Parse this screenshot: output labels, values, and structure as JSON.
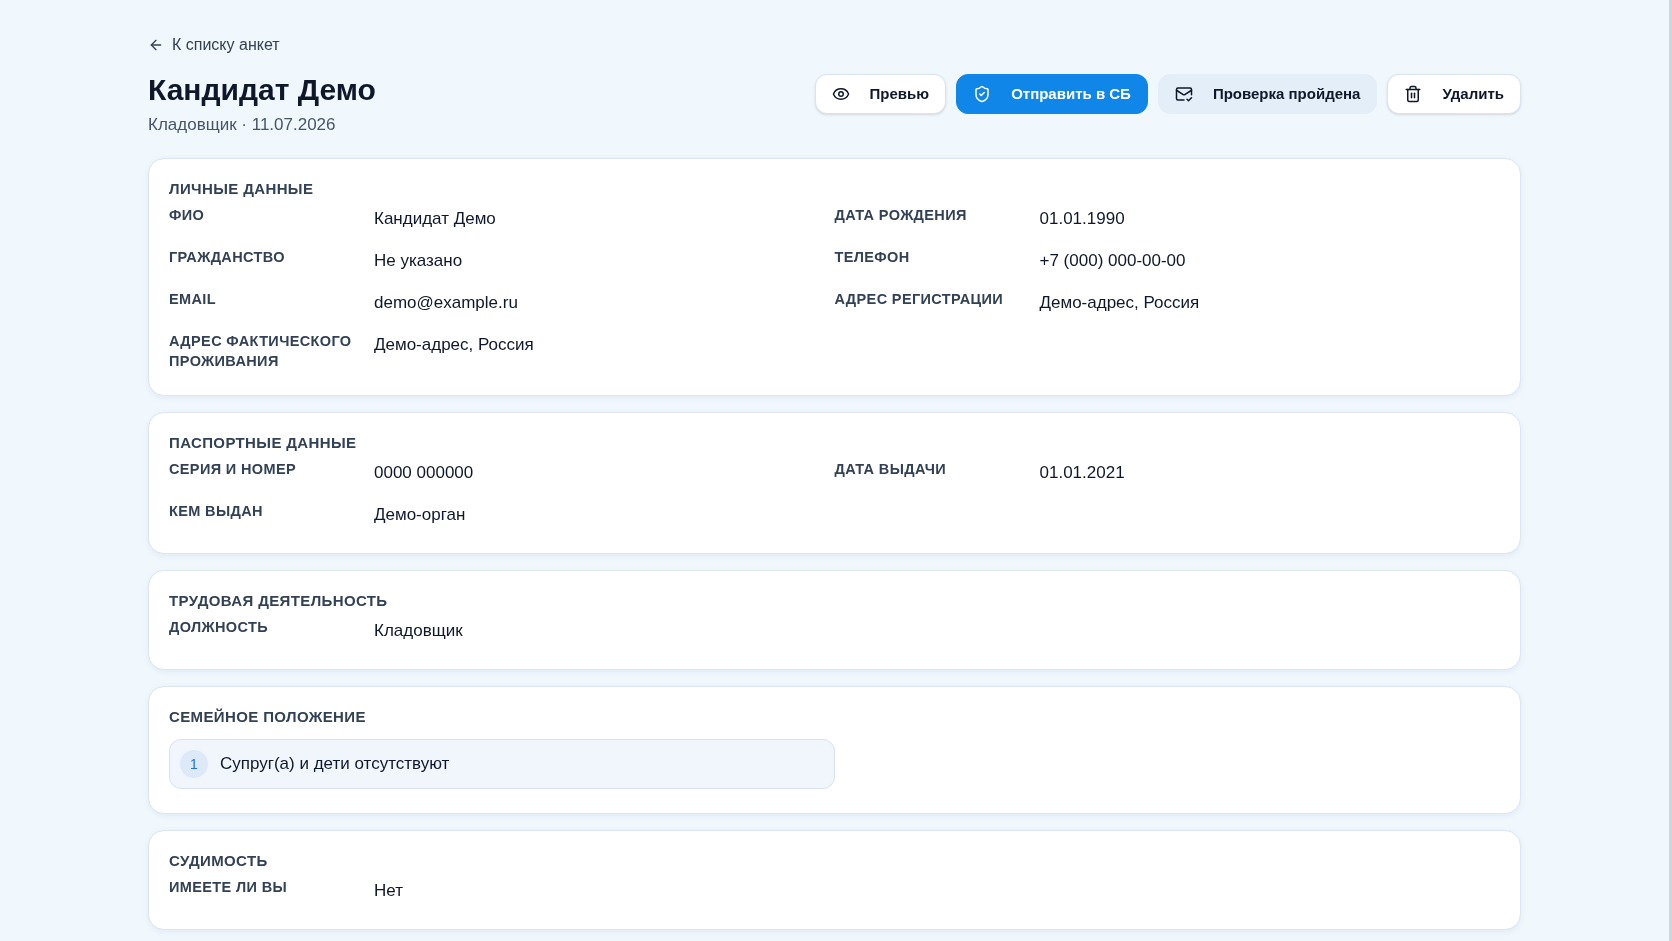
{
  "back_link": "К списку анкет",
  "title": "Кандидат Демо",
  "subtitle": "Кладовщик · 11.07.2026",
  "actions": [
    {
      "label": "Превью",
      "kind": "outline"
    },
    {
      "label": "Отправить в СБ",
      "kind": "primary"
    },
    {
      "label": "Проверка пройдена",
      "kind": "tinted"
    },
    {
      "label": "Удалить",
      "kind": "outline"
    }
  ],
  "sections": [
    {
      "title": "ЛИЧНЫЕ ДАННЫЕ",
      "kind": "fields",
      "fields": [
        {
          "label": "ФИО",
          "value": "Кандидат Демо"
        },
        {
          "label": "ДАТА РОЖДЕНИЯ",
          "value": "01.01.1990"
        },
        {
          "label": "ГРАЖДАНСТВО",
          "value": "Не указано"
        },
        {
          "label": "ТЕЛЕФОН",
          "value": "+7 (000) 000-00-00"
        },
        {
          "label": "EMAIL",
          "value": "demo@example.ru"
        },
        {
          "label": "АДРЕС РЕГИСТРАЦИИ",
          "value": "Демо-адрес, Россия"
        },
        {
          "label": "АДРЕС ФАКТИЧЕСКОГО ПРОЖИВАНИЯ",
          "value": "Демо-адрес, Россия"
        }
      ]
    },
    {
      "title": "ПАСПОРТНЫЕ ДАННЫЕ",
      "kind": "fields",
      "fields": [
        {
          "label": "СЕРИЯ И НОМЕР",
          "value": "0000 000000"
        },
        {
          "label": "ДАТА ВЫДАЧИ",
          "value": "01.01.2021"
        },
        {
          "label": "КЕМ ВЫДАН",
          "value": "Демо-орган"
        }
      ]
    },
    {
      "title": "ТРУДОВАЯ ДЕЯТЕЛЬНОСТЬ",
      "kind": "fields",
      "fields": [
        {
          "label": "ДОЛЖНОСТЬ",
          "value": "Кладовщик"
        }
      ]
    },
    {
      "title": "СЕМЕЙНОЕ ПОЛОЖЕНИЕ",
      "kind": "list",
      "items": [
        {
          "number": "1",
          "text": "Супруг(а) и дети отсутствуют"
        }
      ]
    },
    {
      "title": "СУДИМОСТЬ",
      "kind": "fields",
      "fields": [
        {
          "label": "ИМЕЕТЕ ЛИ ВЫ",
          "value": "Нет"
        }
      ]
    }
  ]
}
